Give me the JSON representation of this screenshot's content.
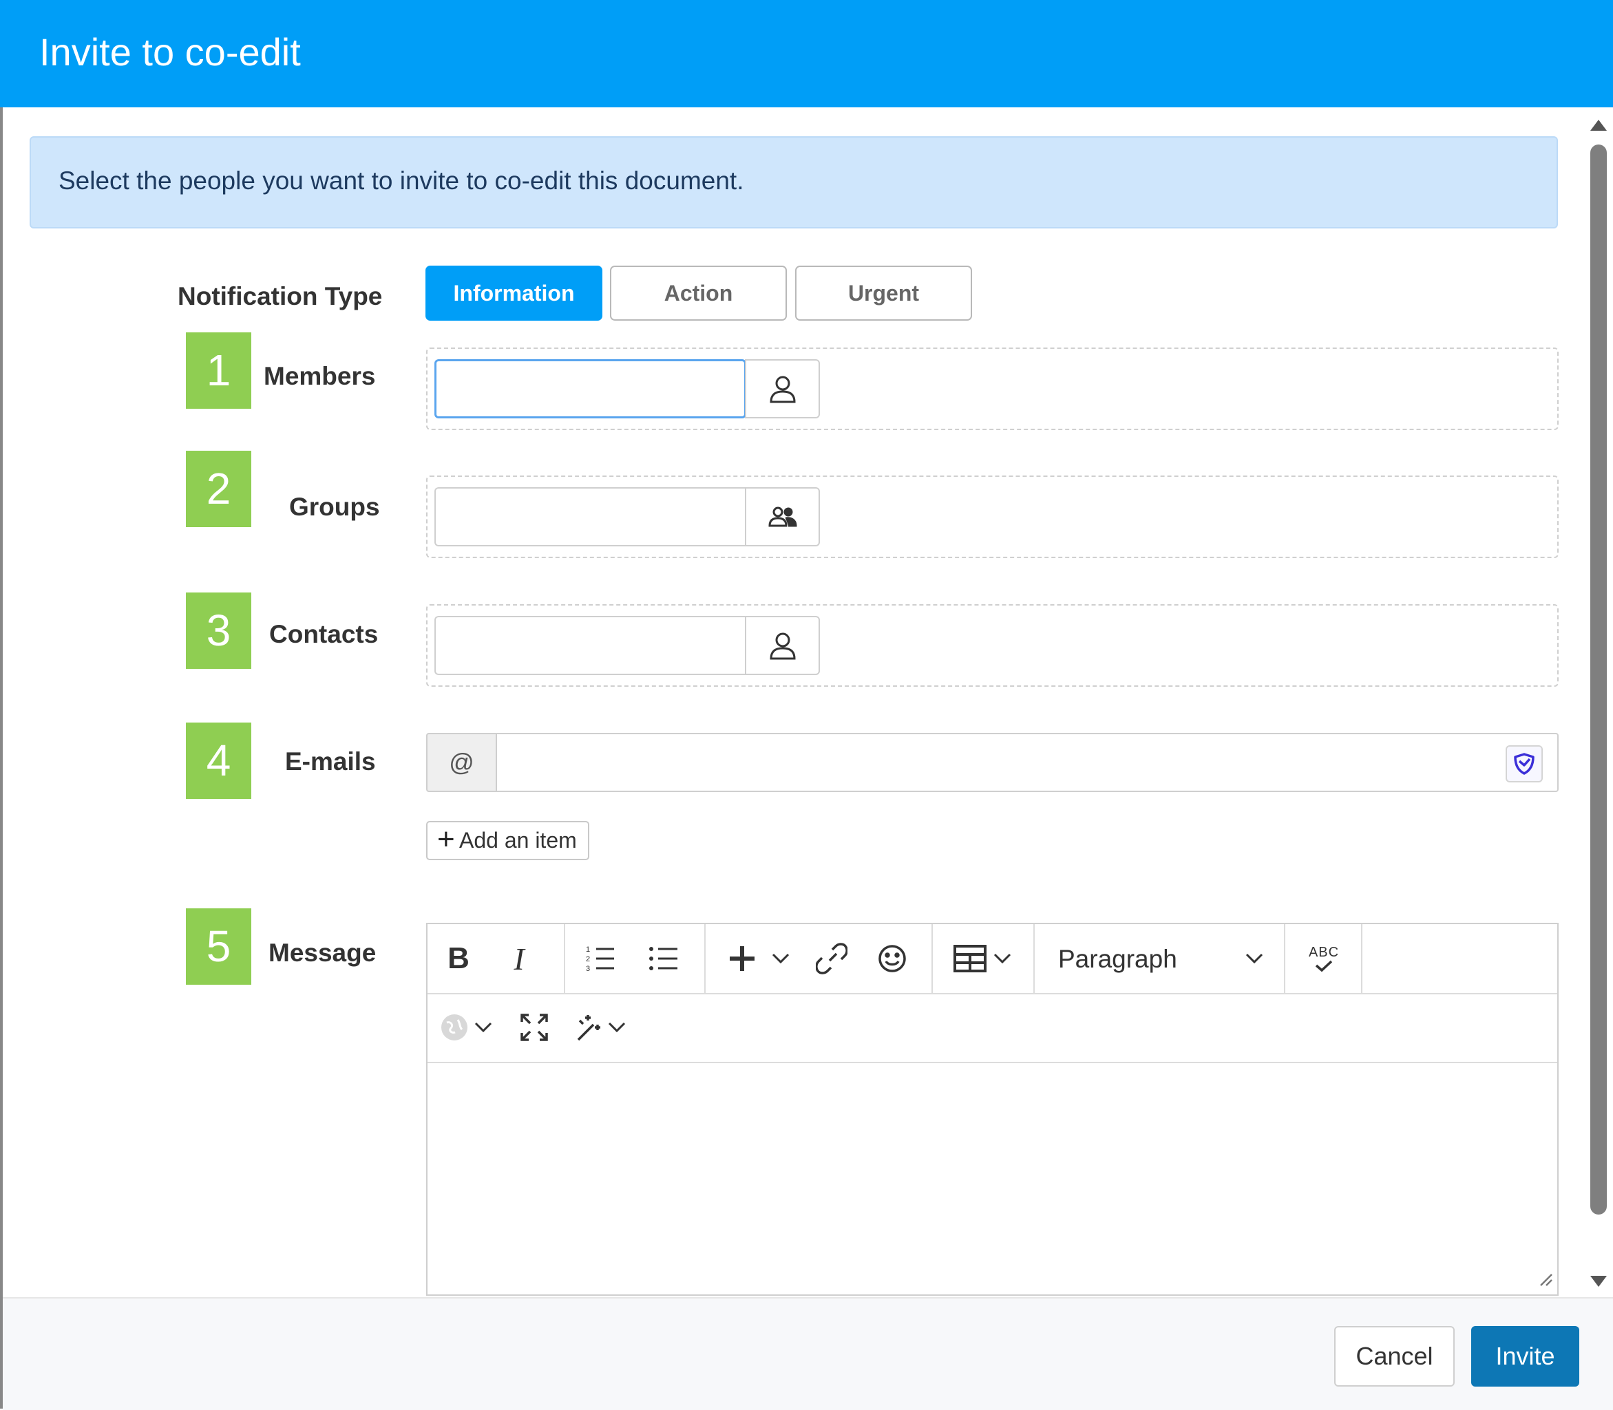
{
  "dialog": {
    "title": "Invite to co-edit"
  },
  "info": {
    "message": "Select the people you want to invite to co-edit this document."
  },
  "notification": {
    "label": "Notification Type",
    "options": [
      "Information",
      "Action",
      "Urgent"
    ],
    "selected": "Information"
  },
  "fields": {
    "members": {
      "badge": "1",
      "label": "Members",
      "icon": "person-icon"
    },
    "groups": {
      "badge": "2",
      "label": "Groups",
      "icon": "group-icon"
    },
    "contacts": {
      "badge": "3",
      "label": "Contacts",
      "icon": "person-icon"
    },
    "emails": {
      "badge": "4",
      "label": "E-mails",
      "prefix": "@",
      "icon": "shield-icon"
    },
    "message": {
      "badge": "5",
      "label": "Message"
    }
  },
  "add_item": {
    "label": "Add an item"
  },
  "editor": {
    "bold": "B",
    "italic": "I",
    "format_select": "Paragraph",
    "spellcheck": "ABC"
  },
  "footer": {
    "cancel": "Cancel",
    "invite": "Invite"
  },
  "colors": {
    "header": "#009ef7",
    "active_button": "#009ef7",
    "badge": "#8fce52",
    "invite_button": "#0d77b5",
    "info_banner": "#cfe6fc"
  }
}
